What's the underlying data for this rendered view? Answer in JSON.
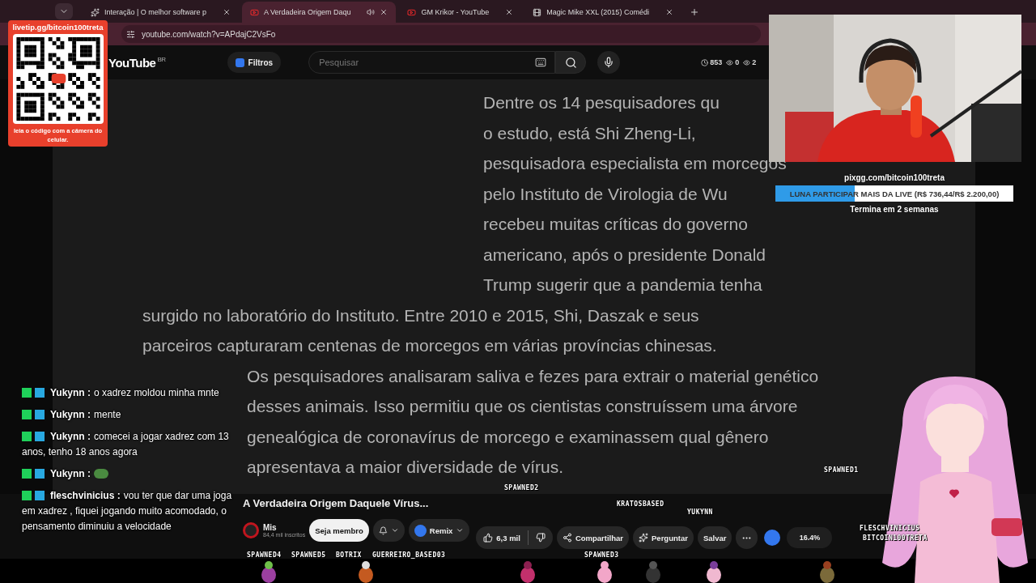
{
  "browser": {
    "tabs": [
      {
        "title": "Interação | O melhor software p",
        "selected": false,
        "kind": "site"
      },
      {
        "title": "A Verdadeira Origem Daqu",
        "selected": true,
        "kind": "youtube"
      },
      {
        "title": "GM Krikor - YouTube",
        "selected": false,
        "kind": "youtube"
      },
      {
        "title": "Magic Mike XXL (2015) Comédi",
        "selected": false,
        "kind": "movie"
      }
    ],
    "address": "youtube.com/watch?v=APdajC2VsFo"
  },
  "header": {
    "logo": "YouTube",
    "region": "BR",
    "filter_button": "Filtros",
    "search": {
      "placeholder": "Pesquisar"
    },
    "stats": [
      "853",
      "0",
      "2"
    ]
  },
  "video_text": {
    "upper_lines": [
      "Dentre os 14 pesquisadores qu",
      "o estudo, está Shi Zheng-Li,",
      "pesquisadora especialista em morcegos",
      "pelo Instituto de Virologia de Wu",
      "recebeu muitas críticas do governo",
      "americano, após o presidente Donald",
      "Trump sugerir que a pandemia tenha"
    ],
    "lower_lines": [
      "surgido no laboratório do Instituto. Entre 2010 e 2015, Shi, Daszak e seus",
      "parceiros capturaram centenas de morcegos em várias províncias chinesas.",
      "Os pesquisadores analisaram saliva e fezes para extrair o material genético",
      "desses animais. Isso permitiu que os cientistas construíssem uma árvore",
      "genealógica de coronavírus de morcego e examinassem qual gênero",
      "apresentava a maior diversidade de vírus."
    ]
  },
  "toolbar": {
    "title": "A Verdadeira Origem Daquele Vírus...",
    "channel": "Mis",
    "subscribers": "84,4 mil inscritos",
    "join_button": "Seja membro",
    "remix_button": "Remix",
    "likes": "6,3 mil",
    "share_button": "Compartilhar",
    "ask_button": "Perguntar",
    "save_button": "Salvar",
    "progress": "16.4%"
  },
  "qr_card": {
    "url": "livetip.gg/bitcoin100treta",
    "caption": "leia o código com a câmera do celular."
  },
  "goal": {
    "url": "pixgg.com/bitcoin100treta",
    "label": "LUNA PARTICIPAR MAIS DA LIVE (R$ 736,44/R$ 2.200,00)",
    "level": 0.335,
    "footer": "Termina em 2 semanas"
  },
  "chat": [
    {
      "user": "Yukynn :",
      "text": "o xadrez moldou minha mnte",
      "kind": "text"
    },
    {
      "user": "Yukynn :",
      "text": "mente",
      "kind": "text"
    },
    {
      "user": "Yukynn :",
      "text": "comecei a jogar xadrez com 13 anos, tenho 18 anos agora",
      "kind": "text"
    },
    {
      "user": "Yukynn :",
      "kind": "emote"
    },
    {
      "user": "fleschvinicius :",
      "text": "vou ter que dar uma joga em xadrez , fiquei jogando muito acomodado, o pensamento diminuiu a velocidade",
      "kind": "text"
    }
  ],
  "sprite_labels": [
    "SPAWNED4",
    "SPAWNED5",
    "BOTRIX",
    "GUERREIRO_BASED03",
    "SPAWNED2",
    "KRATOSBASED",
    "SPAWNED3",
    "YUKYNN",
    "SPAWNED1",
    "FLESCHVINICIUS",
    "BITCOIN100TRETA"
  ]
}
